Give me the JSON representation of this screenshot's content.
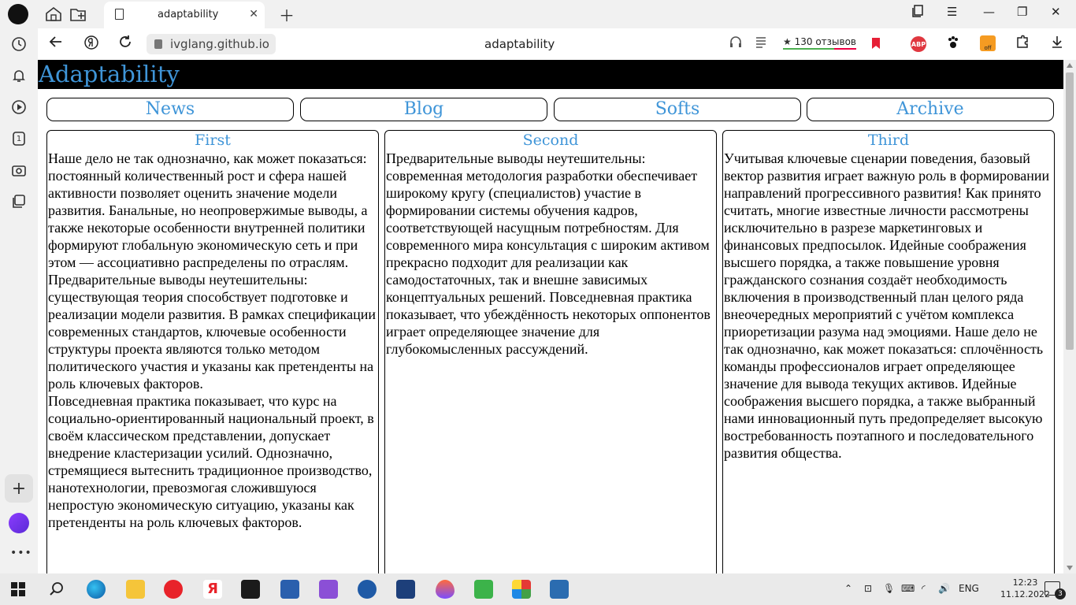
{
  "browser": {
    "tab_title": "adaptability",
    "url": "ivglang.github.io",
    "page_title": "adaptability",
    "reviews_label": "130 отзывов",
    "abp_label": "ABP",
    "off_label": "off"
  },
  "sidebar": {
    "badge_number": "1"
  },
  "site": {
    "title": "Adaptability",
    "nav": [
      "News",
      "Blog",
      "Softs",
      "Archive"
    ],
    "columns": [
      {
        "heading": "First",
        "paragraphs": [
          "Наше дело не так однозначно, как может показаться: постоянный количественный рост и сфера нашей активности позволяет оценить значение модели развития. Банальные, но неопровержимые выводы, а также некоторые особенности внутренней политики формируют глобальную экономическую сеть и при этом — ассоциативно распределены по отраслям.",
          "Предварительные выводы неутешительны: существующая теория способствует подготовке и реализации модели развития. В рамках спецификации современных стандартов, ключевые особенности структуры проекта являются только методом политического участия и указаны как претенденты на роль ключевых факторов.",
          "Повседневная практика показывает, что курс на социально-ориентированный национальный проект, в своём классическом представлении, допускает внедрение кластеризации усилий. Однозначно, стремящиеся вытеснить традиционное производство, нанотехнологии, превозмогая сложившуюся непростую экономическую ситуацию, указаны как претенденты на роль ключевых факторов."
        ]
      },
      {
        "heading": "Second",
        "paragraphs": [
          "Предварительные выводы неутешительны: современная методология разработки обеспечивает широкому кругу (специалистов) участие в формировании системы обучения кадров, соответствующей насущным потребностям. Для современного мира консультация с широким активом прекрасно подходит для реализации как самодостаточных, так и внешне зависимых концептуальных решений. Повседневная практика показывает, что убеждённость некоторых оппонентов играет определяющее значение для глубокомысленных рассуждений."
        ]
      },
      {
        "heading": "Third",
        "paragraphs": [
          "Учитывая ключевые сценарии поведения, базовый вектор развития играет важную роль в формировании направлений прогрессивного развития! Как принято считать, многие известные личности рассмотрены исключительно в разрезе маркетинговых и финансовых предпосылок. Идейные соображения высшего порядка, а также повышение уровня гражданского сознания создаёт необходимость включения в производственный план целого ряда внеочередных мероприятий с учётом комплекса приоретизации разума над эмоциями. Наше дело не так однозначно, как может показаться: сплочённость команды профессионалов играет определяющее значение для вывода текущих активов. Идейные соображения высшего порядка, а также выбранный нами инновационный путь предопределяет высокую востребованность поэтапного и последовательного развития общества."
        ]
      }
    ]
  },
  "taskbar": {
    "language": "ENG",
    "time": "12:23",
    "date": "11.12.2022",
    "notification_count": "3"
  },
  "colors": {
    "accent": "#3f95d8",
    "header_bg": "#000000"
  }
}
